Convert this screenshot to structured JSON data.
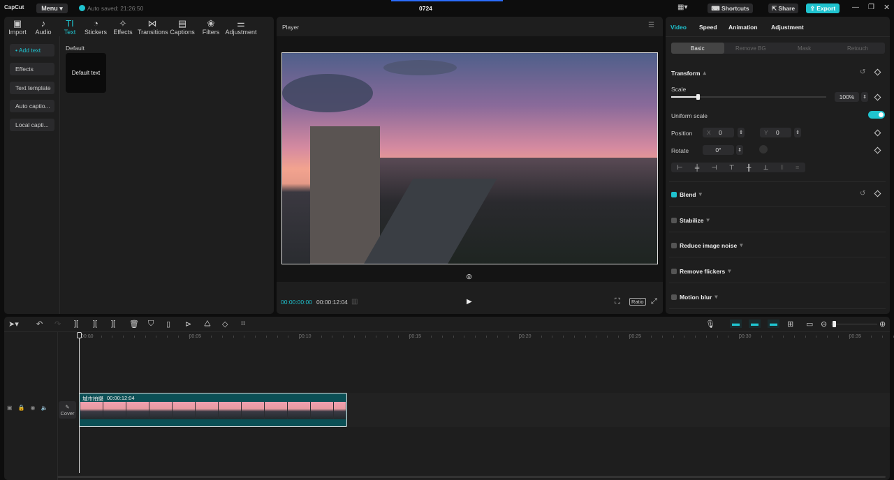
{
  "app": {
    "logo": "CapCut",
    "menu": "Menu",
    "autosave": "Auto saved: 21:26:50",
    "project_title": "0724",
    "shortcuts": "Shortcuts",
    "share": "Share",
    "export": "Export"
  },
  "toolbar": [
    {
      "label": "Import",
      "icon": "▣"
    },
    {
      "label": "Audio",
      "icon": "♪"
    },
    {
      "label": "Text",
      "icon": "TI"
    },
    {
      "label": "Stickers",
      "icon": "◔"
    },
    {
      "label": "Effects",
      "icon": "✧"
    },
    {
      "label": "Transitions",
      "icon": "⋈"
    },
    {
      "label": "Captions",
      "icon": "▤"
    },
    {
      "label": "Filters",
      "icon": "❀"
    },
    {
      "label": "Adjustment",
      "icon": "⚌"
    }
  ],
  "sidebar": [
    "• Add text",
    "Effects",
    "Text template",
    "Auto captio...",
    "Local capti..."
  ],
  "text_panel": {
    "section": "Default",
    "card": "Default text"
  },
  "player": {
    "title": "Player",
    "current_time": "00:00:00:00",
    "duration": "00:00:12:04",
    "ratio": "Ratio"
  },
  "inspector": {
    "tabs": [
      "Video",
      "Speed",
      "Animation",
      "Adjustment"
    ],
    "subtabs": [
      "Basic",
      "Remove BG",
      "Mask",
      "Retouch"
    ],
    "transform": "Transform",
    "scale_label": "Scale",
    "scale_value": "100%",
    "scale_fraction": 0.17,
    "uniform_scale": "Uniform scale",
    "uniform_on": true,
    "position": "Position",
    "x_label": "X",
    "x": "0",
    "y_label": "Y",
    "y": "0",
    "rotate": "Rotate",
    "rotate_value": "0°",
    "sections": [
      {
        "label": "Blend",
        "checked": true
      },
      {
        "label": "Stabilize",
        "checked": false
      },
      {
        "label": "Reduce image noise",
        "checked": false
      },
      {
        "label": "Remove flickers",
        "checked": false
      },
      {
        "label": "Motion blur",
        "checked": false
      }
    ]
  },
  "timeline": {
    "ruler": [
      "00:00",
      "00:05",
      "00:10",
      "00:15",
      "00:20",
      "00:25",
      "00:30",
      "00:35"
    ],
    "cover": "Cover",
    "clip_name": "城市拍摄",
    "clip_duration": "00:00:12:04"
  },
  "colors": {
    "accent": "#1fc3cf",
    "clip": "#0b4f55"
  }
}
